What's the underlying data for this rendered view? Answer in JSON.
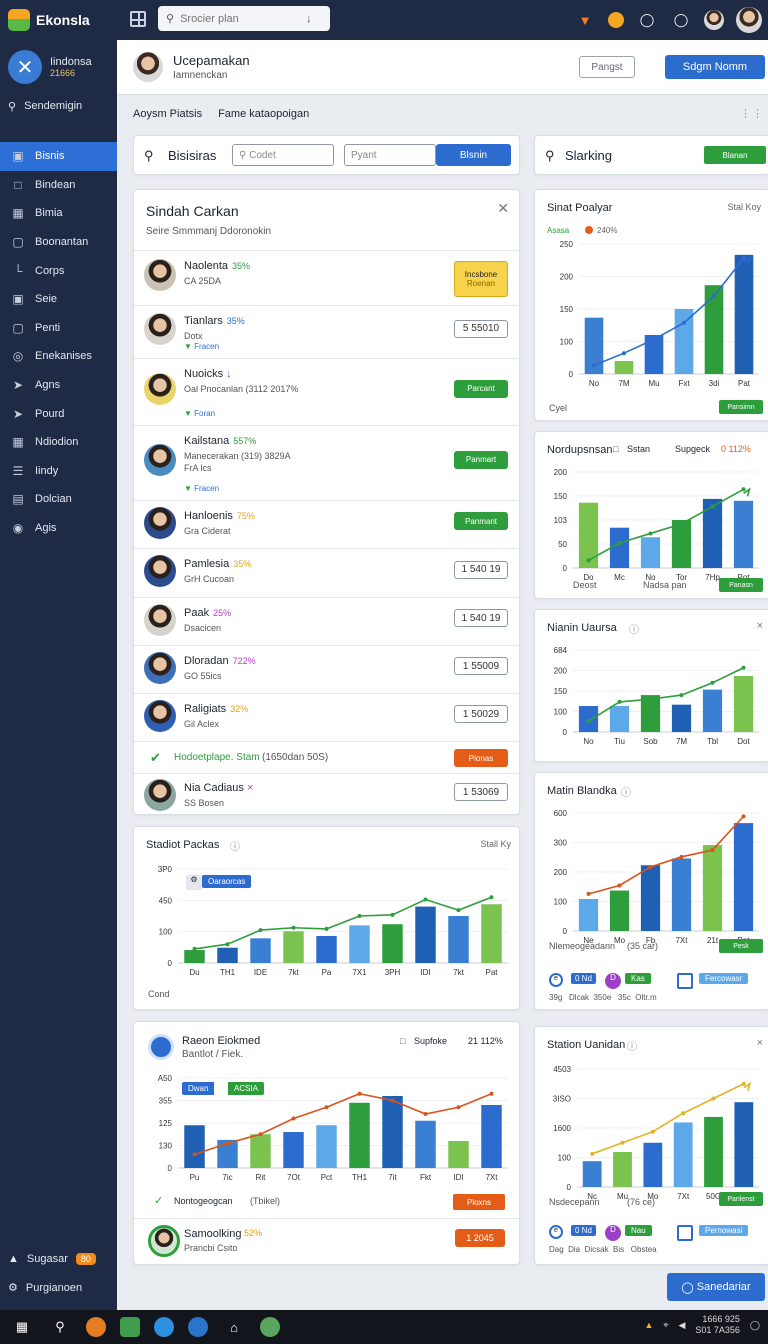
{
  "topbar": {
    "app_name": "Ekonsla",
    "search_placeholder": "Srocier plan"
  },
  "sidebar": {
    "brand_title": "Iindonsa",
    "brand_sub": "21666",
    "search_label": "Sendemigin",
    "items": [
      {
        "label": "Bisnis",
        "icon": "dashboard-icon"
      },
      {
        "label": "Bindean",
        "icon": "doc-icon"
      },
      {
        "label": "Bimia",
        "icon": "table-icon"
      },
      {
        "label": "Boonantan",
        "icon": "box-icon"
      },
      {
        "label": "Corps",
        "icon": "tree-icon"
      },
      {
        "label": "Seie",
        "icon": "lock-icon"
      },
      {
        "label": "Penti",
        "icon": "box-icon"
      },
      {
        "label": "Enekanises",
        "icon": "globe-icon"
      },
      {
        "label": "Agns",
        "icon": "send-icon"
      },
      {
        "label": "Pourd",
        "icon": "send-icon"
      },
      {
        "label": "Ndiodion",
        "icon": "grid-icon"
      },
      {
        "label": "Iindy",
        "icon": "list-icon"
      },
      {
        "label": "Dolcian",
        "icon": "report-icon"
      },
      {
        "label": "Agis",
        "icon": "pin-icon"
      }
    ],
    "footer_1": "Sugasar",
    "footer_1_badge": "80",
    "footer_2": "Purgianoen"
  },
  "header": {
    "name": "Ucepamakan",
    "sub": "Iamnenckan",
    "ghost_btn": "Pangst",
    "primary_btn": "Sdgm Nomm"
  },
  "subbar": {
    "left": "Aoysm Piatsis",
    "right": "Fame kataopoigan"
  },
  "bisnis_toolbar": {
    "title": "Bisisiras",
    "field1": "Codet",
    "field2": "Pyant",
    "button": "Blsnin"
  },
  "starling_toolbar": {
    "title": "Slarking",
    "button": "Blanan"
  },
  "list": {
    "title": "Sindah Carkan",
    "subtitle": "Seire Smmmanj Ddoronokin",
    "rows": [
      {
        "name": "Naolenta",
        "pct": "35%",
        "pct_color": "#2e9e3d",
        "sub": "CA 25DA",
        "tag": "",
        "btn": "Incsbone",
        "btn2": "Roenan",
        "btn_type": "yellow"
      },
      {
        "name": "Tianlars",
        "pct": "35%",
        "pct_color": "#2d6fd4",
        "sub": "Dotx",
        "tag": "Fracen",
        "btn": "5 55010",
        "btn_type": "outline"
      },
      {
        "name": "Nuoicks",
        "pct": "",
        "pct_color": "#2d6fd4",
        "sub": "Oal Pnocanlan (3112 2017%",
        "tag": "Foran",
        "btn": "Parcant",
        "btn_type": "green"
      },
      {
        "name": "Kailstana",
        "pct": "557%",
        "pct_color": "#2e9e3d",
        "sub": "Manecerakan (319) 3829A",
        "sub2": "FrA lcs",
        "tag": "Fracen",
        "btn": "Panmart",
        "btn_type": "green"
      },
      {
        "name": "Hanloenis",
        "pct": "75%",
        "pct_color": "#e3a21a",
        "sub": "Gra Ciderat",
        "tag": "",
        "btn": "Panmant",
        "btn_type": "green"
      },
      {
        "name": "Pamlesia",
        "pct": "35%",
        "pct_color": "#e3a21a",
        "sub": "GrH Cucoan",
        "tag": "",
        "btn": "1 540 19",
        "btn_type": "outline"
      },
      {
        "name": "Paak",
        "pct": "25%",
        "pct_color": "#b43cc8",
        "sub": "Dsacicen",
        "tag": "",
        "btn": "1 540 19",
        "btn_type": "outline"
      },
      {
        "name": "Dloradan",
        "pct": "722%",
        "pct_color": "#b43cc8",
        "sub": "GO 55ics",
        "tag": "",
        "btn": "1 55009",
        "btn_type": "outline"
      },
      {
        "name": "Raligiats",
        "pct": "32%",
        "pct_color": "#e3a21a",
        "sub": "Gil Aclex",
        "tag": "",
        "btn": "1 50029",
        "btn_type": "outline"
      }
    ],
    "alert_text": "Hodoetplape. Stam",
    "alert_extra": "(1650dan 50S)",
    "alert_btn": "Pionas",
    "last_name": "Nia Cadiaus",
    "last_sub": "SS Bosen",
    "last_btn": "1 53069"
  },
  "chart_data": [
    {
      "id": "sinat",
      "type": "bar",
      "title": "Sinat Poalyar",
      "corner": "Stal Koy",
      "legend": "Asasa",
      "legend_pct": "240%",
      "categories": [
        "No",
        "7M",
        "Mu",
        "Fxt",
        "3di",
        "Pat"
      ],
      "ylim": [
        0,
        300
      ],
      "yticks": [
        "0",
        "100",
        "150",
        "200",
        "250"
      ],
      "series": [
        {
          "values": [
            130,
            30,
            90,
            150,
            205,
            275
          ]
        },
        {
          "line": [
            20,
            48,
            80,
            118,
            180,
            268
          ]
        }
      ],
      "xlabel": "Cyel",
      "btn": "Pansimn"
    },
    {
      "id": "nodupsian",
      "type": "bar",
      "title": "Nordupsnsan",
      "legend": "Sstan",
      "legend2": "Supgeck",
      "legend3": "0 112%",
      "categories": [
        "Do",
        "Mc",
        "No",
        "Tor",
        "7Hp",
        "Pot"
      ],
      "ylim": [
        0,
        250
      ],
      "yticks": [
        "0",
        "50",
        "103",
        "150",
        "200"
      ],
      "series": [
        {
          "values": [
            170,
            105,
            80,
            125,
            180,
            175
          ]
        },
        {
          "line": [
            20,
            65,
            90,
            115,
            160,
            205
          ]
        }
      ],
      "xlabel": "Deost",
      "xlabel2": "Nadsa pan",
      "btn": "Panasn"
    },
    {
      "id": "niauan",
      "type": "bar",
      "title": "Nianin Uaursa",
      "categories": [
        "No",
        "Tiu",
        "Sob",
        "7M",
        "Tbl",
        "Dot"
      ],
      "ylim": [
        0,
        300
      ],
      "yticks": [
        "0",
        "100",
        "150",
        "200",
        "684"
      ],
      "series": [
        {
          "values": [
            95,
            95,
            135,
            100,
            155,
            205
          ]
        },
        {
          "line": [
            40,
            110,
            120,
            135,
            180,
            235
          ]
        }
      ]
    },
    {
      "id": "matin",
      "type": "bar",
      "title": "Matin Blandka",
      "categories": [
        "Ne",
        "Mo",
        "Fb",
        "7Xt",
        "21t",
        "Pet"
      ],
      "ylim": [
        0,
        350
      ],
      "yticks": [
        "0",
        "100",
        "200",
        "300",
        "600"
      ],
      "series": [
        {
          "values": [
            95,
            120,
            195,
            215,
            255,
            320
          ]
        },
        {
          "line": [
            110,
            135,
            190,
            220,
            240,
            340
          ]
        }
      ],
      "xlabel": "Nlemeogeadann",
      "xlabel_extra": "(35 car)",
      "btn": "Pesk",
      "chips": [
        "0 Nd",
        "Kas",
        "Fercowasr"
      ],
      "chip_caption": "39g   Dlcak  350e   35c  Oltr.m"
    },
    {
      "id": "stadiot",
      "type": "bar",
      "title": "Stadiot Packas",
      "corner": "Stall Ky",
      "legend": "Oaraorcas",
      "categories": [
        "Du",
        "TH1",
        "IDE",
        "7kt",
        "Pa",
        "7X1",
        "3PH",
        "IDI",
        "7kt",
        "Pat"
      ],
      "ylim": [
        0,
        400
      ],
      "yticks": [
        "0",
        "100",
        "450",
        "3P0"
      ],
      "series": [
        {
          "values": [
            55,
            65,
            105,
            135,
            115,
            160,
            165,
            240,
            200,
            250
          ]
        },
        {
          "line": [
            60,
            80,
            140,
            150,
            145,
            200,
            205,
            270,
            225,
            280
          ]
        }
      ],
      "xlabel": "Cond"
    },
    {
      "id": "raeon",
      "type": "bar",
      "title": "Raeon Eiokmed",
      "subtitle": "Bantlot / Fiek.",
      "legend": "Supfoke",
      "legend_pct": "21 112%",
      "chip1": "Dwan",
      "chip2": "ACSIA",
      "categories": [
        "Pu",
        "7ic",
        "Rit",
        "7Ot",
        "Pct",
        "TH1",
        "7it",
        "Fkt",
        "IDI",
        "7Xt"
      ],
      "ylim": [
        0,
        400
      ],
      "yticks": [
        "0",
        "130",
        "125",
        "355",
        "A50"
      ],
      "series": [
        {
          "values": [
            190,
            125,
            150,
            160,
            190,
            290,
            320,
            210,
            120,
            280
          ]
        },
        {
          "line": [
            60,
            110,
            150,
            220,
            270,
            330,
            300,
            240,
            270,
            330
          ]
        }
      ],
      "footer": "Nontogeogcan",
      "footer_extra": "(Tbikel)",
      "btn": "Ploxns",
      "last_name": "Samoolking",
      "last_pct": "52%",
      "last_sub": "Prancbi Csito",
      "last_btn": "1 2045"
    },
    {
      "id": "station",
      "type": "bar",
      "title": "Station Uanidan",
      "categories": [
        "Nc",
        "Mu",
        "Mo",
        "7Xt",
        "50G",
        "Pet"
      ],
      "ylim": [
        0,
        320
      ],
      "yticks": [
        "0",
        "100",
        "1600",
        "3ISO",
        "4503"
      ],
      "series": [
        {
          "values": [
            70,
            95,
            120,
            175,
            190,
            230
          ]
        },
        {
          "line": [
            90,
            120,
            150,
            200,
            240,
            280
          ]
        }
      ],
      "xlabel": "Nsdecepann",
      "xlabel_extra": "(76 ce)",
      "btn": "Panlenst",
      "chips": [
        "0 Nd",
        "Nau",
        "Pernowasi"
      ],
      "chip_caption": "Dag  Dia  Dicsak  Bis   Obstea"
    }
  ],
  "floating_btn": "Sanedariar",
  "taskbar": {
    "time": "1666 925",
    "date": "S01 7A356"
  }
}
